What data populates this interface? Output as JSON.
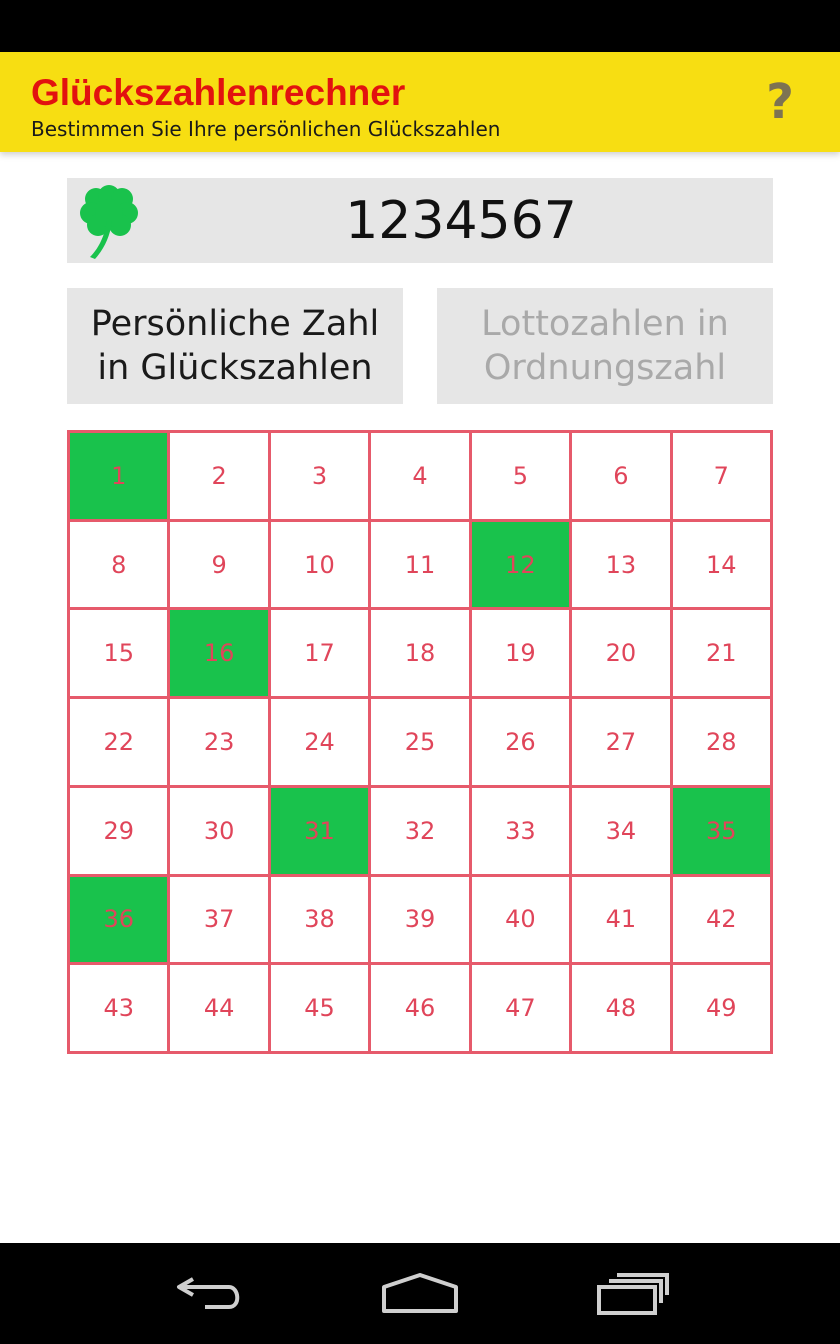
{
  "header": {
    "title": "Glückszahlenrechner",
    "subtitle": "Bestimmen Sie Ihre persönlichen Glückszahlen",
    "help_label": "?"
  },
  "number_display": {
    "icon": "clover-icon",
    "value": "1234567"
  },
  "buttons": {
    "personal_to_lucky": "Persönliche Zahl\nin Glückszahlen",
    "lotto_to_ordinal": "Lottozahlen in\nOrdnungszahl"
  },
  "grid": {
    "numbers": [
      1,
      2,
      3,
      4,
      5,
      6,
      7,
      8,
      9,
      10,
      11,
      12,
      13,
      14,
      15,
      16,
      17,
      18,
      19,
      20,
      21,
      22,
      23,
      24,
      25,
      26,
      27,
      28,
      29,
      30,
      31,
      32,
      33,
      34,
      35,
      36,
      37,
      38,
      39,
      40,
      41,
      42,
      43,
      44,
      45,
      46,
      47,
      48,
      49
    ],
    "highlighted": [
      1,
      12,
      16,
      31,
      35,
      36
    ]
  },
  "colors": {
    "header_bg": "#f7de12",
    "title": "#e2120f",
    "grid_border": "#e65a6b",
    "number_text": "#e0455a",
    "highlight": "#19c24c"
  },
  "nav": {
    "back": "back-icon",
    "home": "home-icon",
    "recents": "recents-icon"
  }
}
